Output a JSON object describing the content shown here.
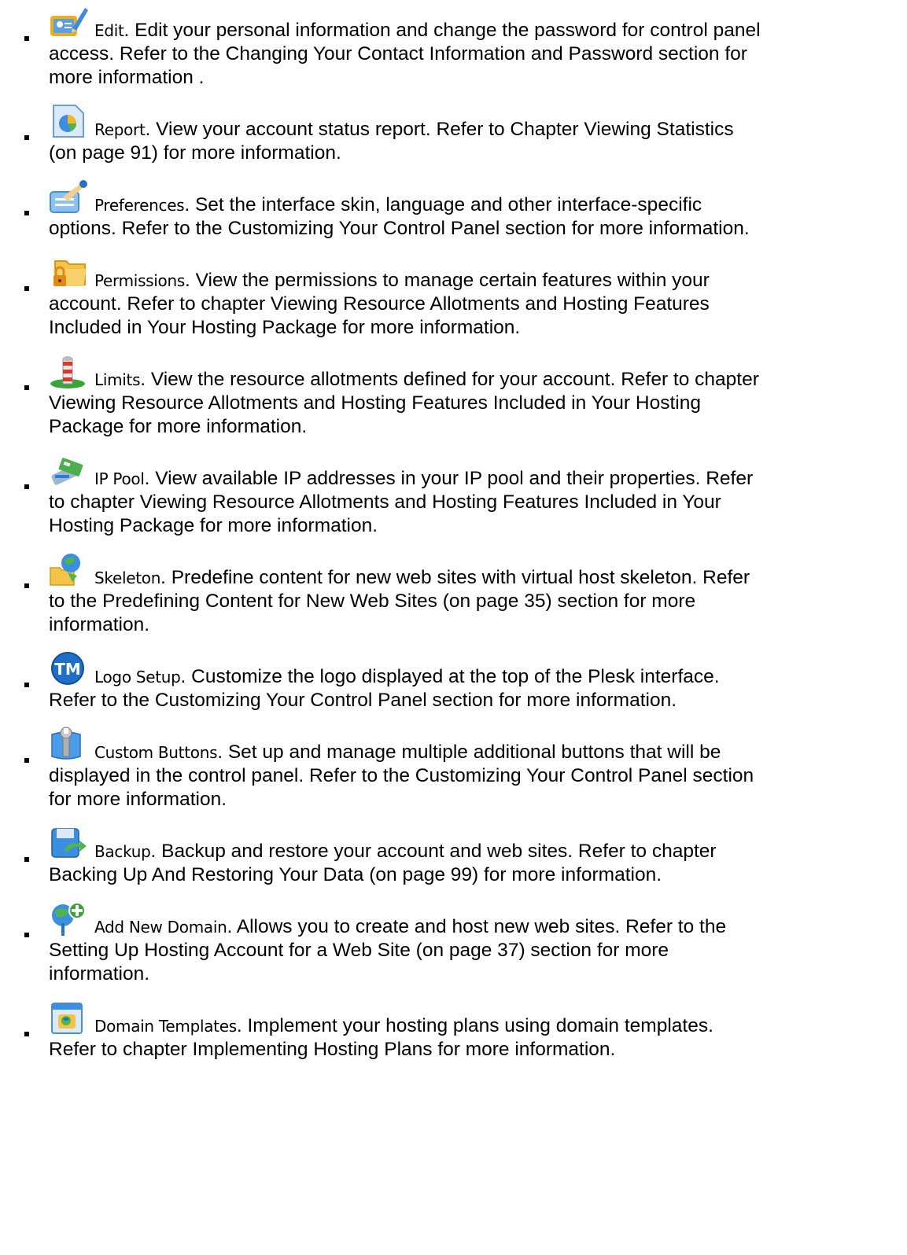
{
  "items": [
    {
      "icon": "edit-icon",
      "label": "Edit",
      "body": ". Edit your personal information and change the password for control panel",
      "rest": "access. Refer to the Changing Your Contact Information and Password section for\nmore information ."
    },
    {
      "icon": "report-icon",
      "label": "Report",
      "body": ". View your account status report. Refer to Chapter Viewing Statistics",
      "rest": "(on page 91) for more information."
    },
    {
      "icon": "preferences-icon",
      "label": "Preferences",
      "body": ". Set the interface skin, language and other interface-specific",
      "rest": "options. Refer to the Customizing Your Control Panel section for more information."
    },
    {
      "icon": "permissions-icon",
      "label": "Permissions",
      "body": ". View the permissions to manage certain features within your",
      "rest": "account. Refer to chapter Viewing Resource Allotments and Hosting Features\nIncluded in Your Hosting Package for more information."
    },
    {
      "icon": "limits-icon",
      "label": "Limits",
      "body": ". View the resource allotments defined for your account. Refer to chapter",
      "rest": "Viewing Resource Allotments and Hosting Features Included in Your Hosting\nPackage for more information."
    },
    {
      "icon": "ip-pool-icon",
      "label": "IP Pool",
      "body": ". View available IP addresses in your IP pool and their properties. Refer",
      "rest": "to chapter Viewing Resource Allotments and Hosting Features Included in Your\nHosting Package for more information."
    },
    {
      "icon": "skeleton-icon",
      "label": "Skeleton",
      "body": ". Predefine content for new web sites with virtual host skeleton. Refer",
      "rest": "to the Predefining Content for New Web Sites (on page 35) section for more\ninformation."
    },
    {
      "icon": "logo-setup-icon",
      "label": "Logo Setup",
      "body": ". Customize the logo displayed at the top of the Plesk interface.",
      "rest": "Refer to the Customizing Your Control Panel section for more information."
    },
    {
      "icon": "custom-buttons-icon",
      "label": "Custom Buttons",
      "body": ". Set up and manage multiple additional buttons that will be",
      "rest": "displayed in the control panel. Refer to the Customizing Your Control Panel section\nfor more information."
    },
    {
      "icon": "backup-icon",
      "label": "Backup",
      "body": ". Backup and restore your account and web sites. Refer to chapter",
      "rest": "Backing Up And Restoring Your Data (on page 99) for more information."
    },
    {
      "icon": "add-new-domain-icon",
      "label": "Add New Domain",
      "body": ". Allows you to create and host new web sites. Refer to the",
      "rest": "Setting Up Hosting Account for a Web Site (on page 37) section for more\ninformation."
    },
    {
      "icon": "domain-templates-icon",
      "label": "Domain Templates",
      "body": ". Implement your hosting plans using domain templates.",
      "rest": "Refer to chapter Implementing Hosting Plans for more information."
    }
  ],
  "icon_text": {
    "logo_setup_mark": "TM"
  },
  "colors": {
    "text": "#000000",
    "background": "#ffffff",
    "icon_blue": "#2a7fd4",
    "icon_yellow": "#f2b51c",
    "icon_green": "#3aa33a",
    "icon_red": "#d63a2a"
  }
}
